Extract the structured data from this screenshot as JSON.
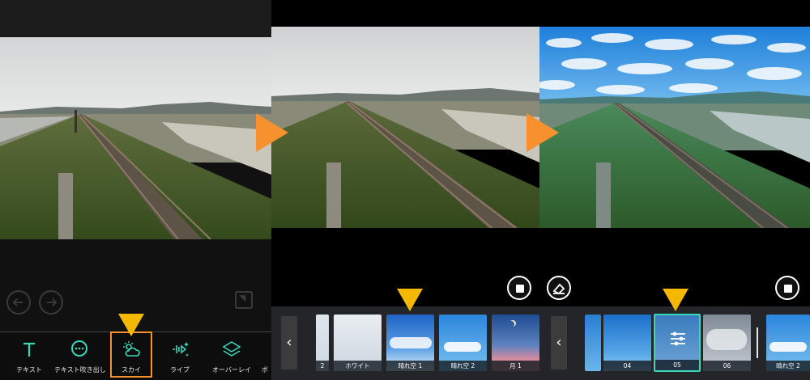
{
  "toolbar": {
    "tools": [
      {
        "label": "テキスト",
        "icon": "text-icon"
      },
      {
        "label": "テキスト吹き出し",
        "icon": "speech-bubble-icon"
      },
      {
        "label": "スカイ",
        "icon": "sky-cloud-sun-icon"
      },
      {
        "label": "ライブ",
        "icon": "live-sparkle-icon"
      },
      {
        "label": "オーバーレイ",
        "icon": "layers-icon"
      },
      {
        "label": "ボ",
        "icon": "partial-tool"
      }
    ],
    "selected": "スカイ"
  },
  "sky_strip_1": {
    "items": [
      {
        "label": "2",
        "sky": "pale"
      },
      {
        "label": "ホワイト",
        "sky": "white"
      },
      {
        "label": "晴れ空 1",
        "sky": "blue-clouds"
      },
      {
        "label": "晴れ空 2",
        "sky": "blue-sun"
      },
      {
        "label": "月 1",
        "sky": "moon-dusk"
      }
    ]
  },
  "sky_strip_2": {
    "items": [
      {
        "label": "",
        "sky": "blue-partial"
      },
      {
        "label": "04",
        "sky": "blue"
      },
      {
        "label": "05",
        "sky": "adjust-selected"
      },
      {
        "label": "06",
        "sky": "storm-clouds"
      },
      {
        "label": "晴れ空 2",
        "sky": "blue-sun"
      }
    ],
    "selected": "05"
  },
  "colors": {
    "accent_orange": "#f7902f",
    "marker_yellow": "#f5b800",
    "selected_border": "#3ad6b8",
    "tool_icon": "#3ad6b8"
  }
}
